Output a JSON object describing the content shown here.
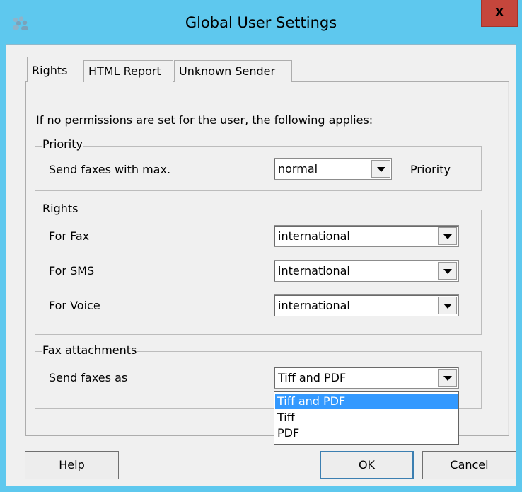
{
  "window": {
    "title": "Global User Settings",
    "close_glyph": "x",
    "icon": "users-icon"
  },
  "tabs": [
    {
      "label": "Rights",
      "active": true
    },
    {
      "label": "HTML Report",
      "active": false
    },
    {
      "label": "Unknown Sender",
      "active": false
    }
  ],
  "rights_tab": {
    "intro": "If no permissions are set for the user, the following applies:",
    "priority_group": {
      "legend": "Priority",
      "row_label": "Send faxes with max.",
      "value": "normal",
      "suffix": "Priority"
    },
    "rights_group": {
      "legend": "Rights",
      "fax_label": "For Fax",
      "fax_value": "international",
      "sms_label": "For SMS",
      "sms_value": "international",
      "voice_label": "For Voice",
      "voice_value": "international"
    },
    "attachments_group": {
      "legend": "Fax attachments",
      "row_label": "Send faxes as",
      "value": "Tiff and PDF",
      "options": [
        "Tiff and PDF",
        "Tiff",
        "PDF"
      ],
      "highlighted_option": "Tiff and PDF"
    }
  },
  "buttons": {
    "help": "Help",
    "ok": "OK",
    "cancel": "Cancel"
  },
  "colors": {
    "titlebar": "#5ec8ee",
    "close_button": "#c5463c",
    "selection": "#3399ff",
    "dialog_bg": "#f0f0f0"
  }
}
